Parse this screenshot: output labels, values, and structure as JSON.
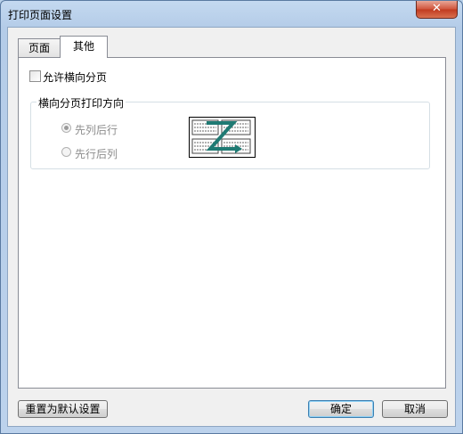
{
  "window": {
    "title": "打印页面设置",
    "close_glyph": "✕"
  },
  "tabs": [
    {
      "label": "页面",
      "selected": false
    },
    {
      "label": "其他",
      "selected": true
    }
  ],
  "options": {
    "allow_landscape_paging": {
      "label": "允许横向分页",
      "checked": false
    }
  },
  "direction_group": {
    "title": "横向分页打印方向",
    "radios": [
      {
        "label": "先列后行",
        "selected": true,
        "enabled": false
      },
      {
        "label": "先行后列",
        "selected": false,
        "enabled": false
      }
    ],
    "preview_icon": "z-order-paging-preview-icon"
  },
  "buttons": {
    "reset": "重置为默认设置",
    "ok": "确定",
    "cancel": "取消"
  },
  "colors": {
    "preview_arrow": "#1f7a73",
    "default_button_border": "#3c7fb1"
  }
}
